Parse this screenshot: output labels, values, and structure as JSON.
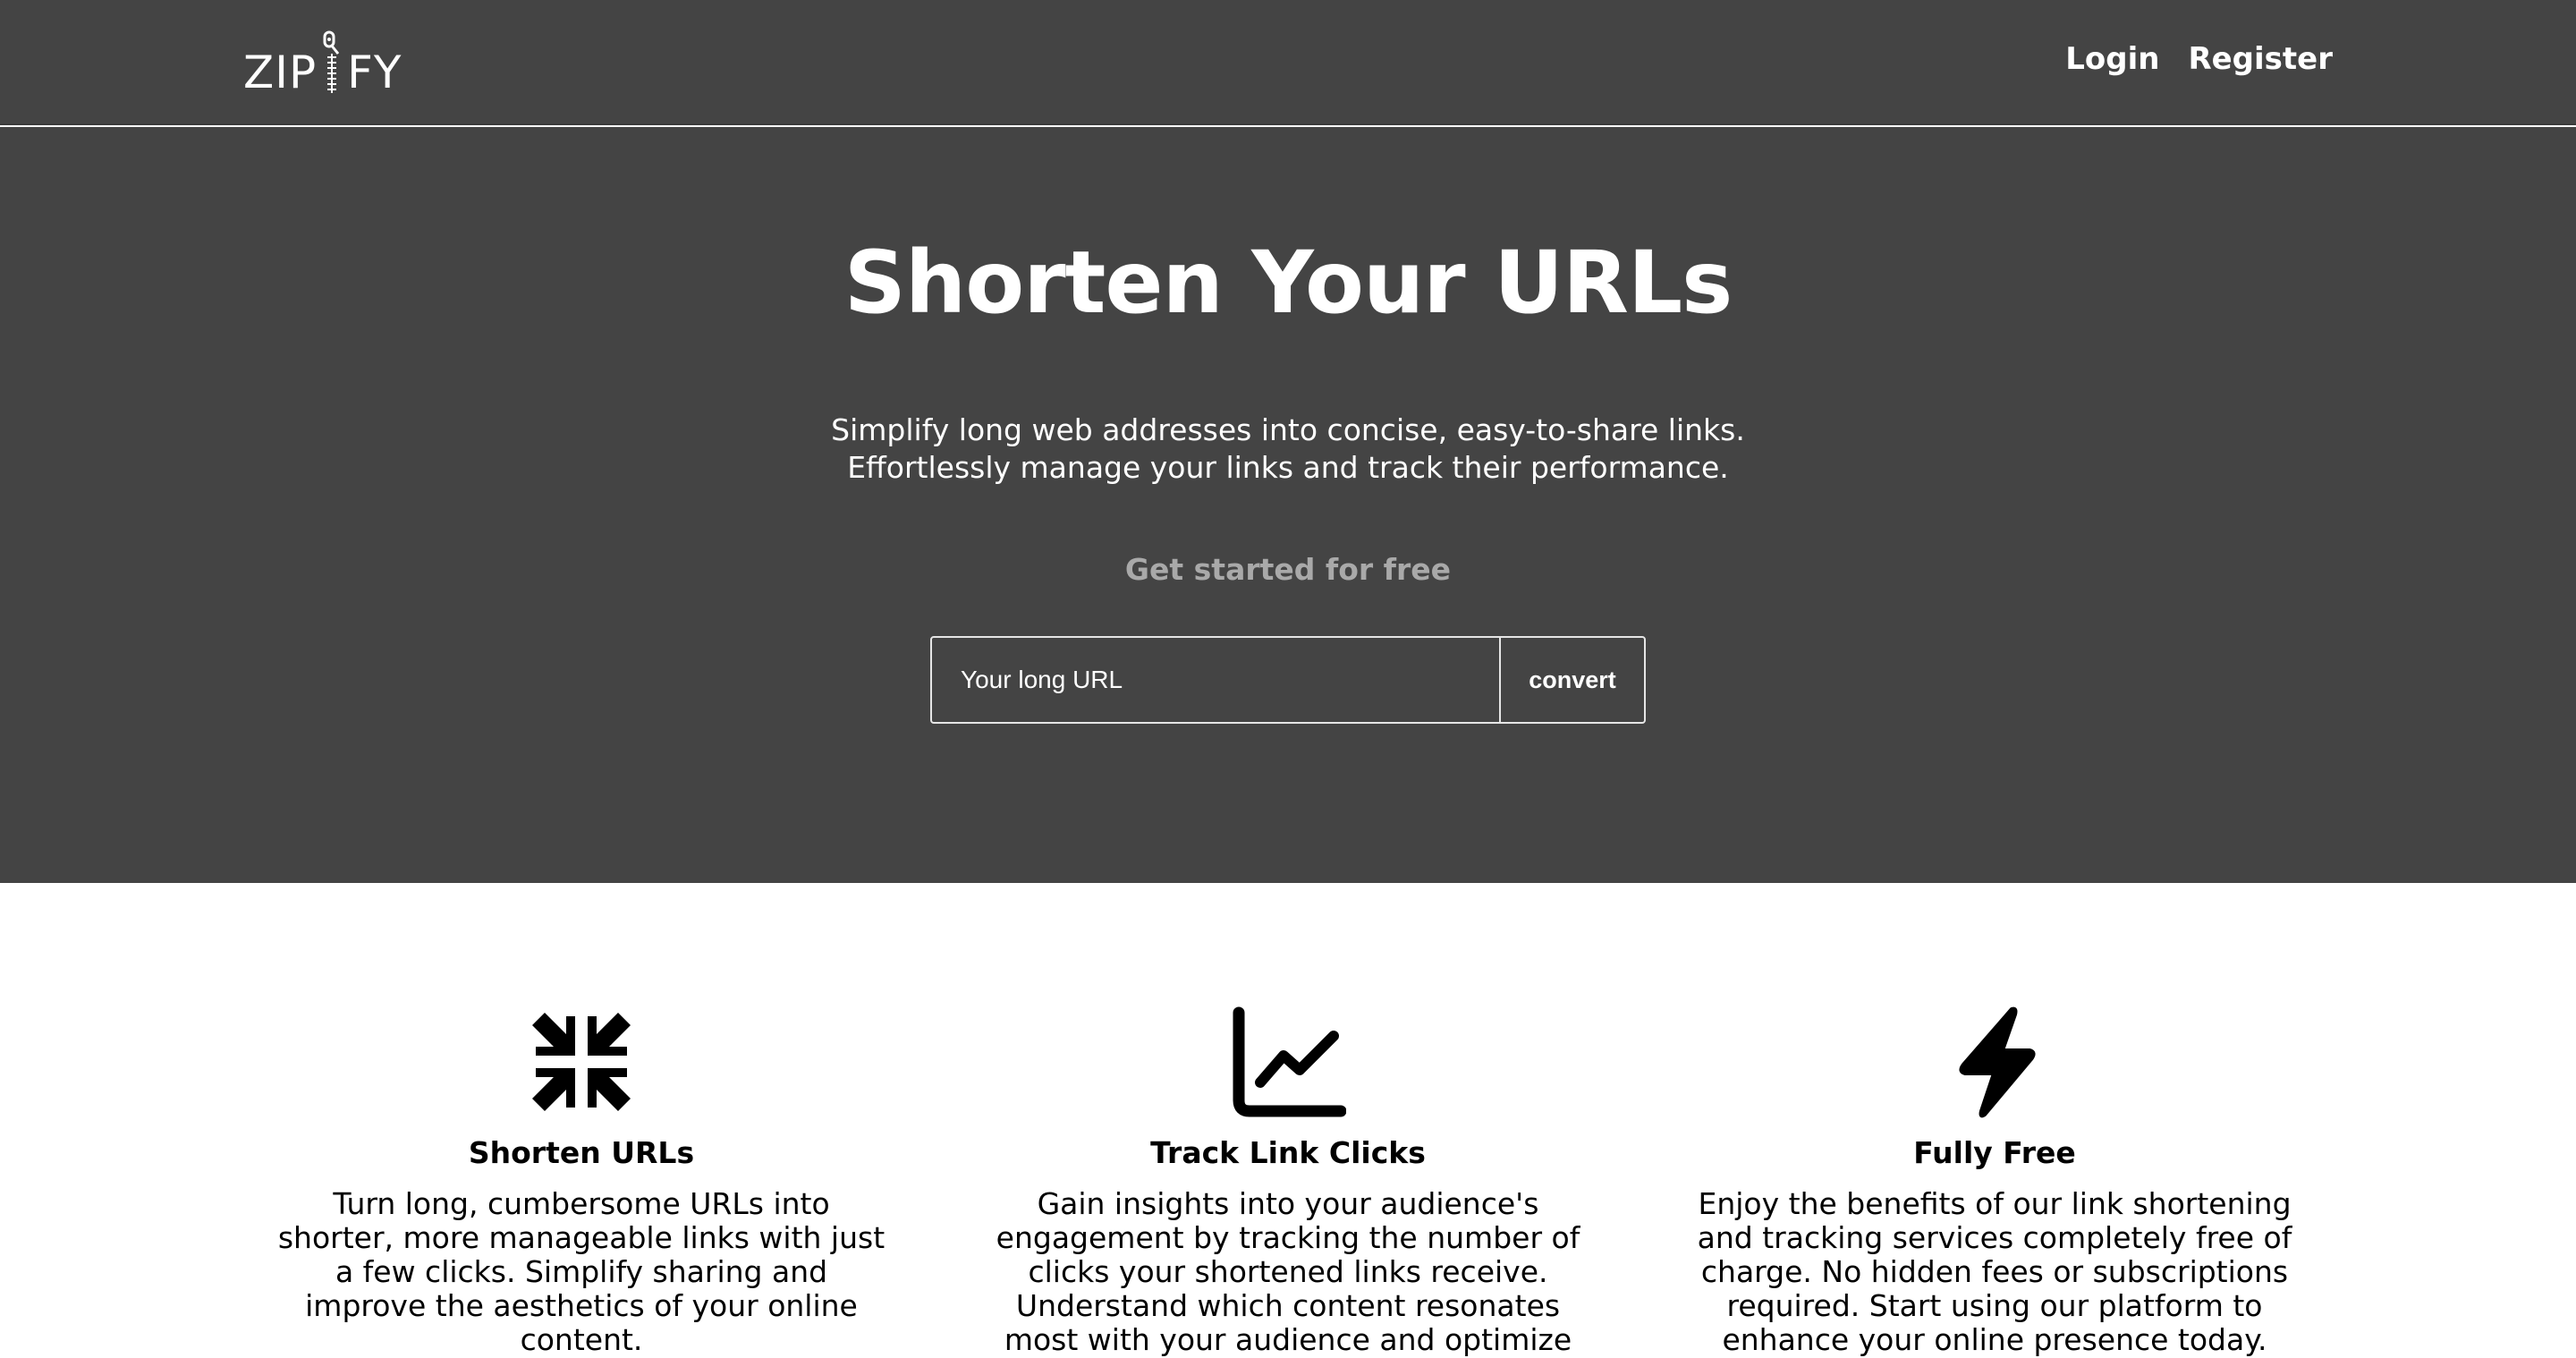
{
  "header": {
    "logo": {
      "left": "ZIP",
      "right": "FY"
    },
    "nav": {
      "login": "Login",
      "register": "Register"
    }
  },
  "hero": {
    "title": "Shorten Your URLs",
    "subtitle_line1": "Simplify long web addresses into concise, easy-to-share links.",
    "subtitle_line2": "Effortlessly manage your links and track their performance.",
    "cta": "Get started for free",
    "url_input": {
      "placeholder": "Your long URL",
      "value": ""
    },
    "convert_label": "convert"
  },
  "features": [
    {
      "icon": "compress-arrows-icon",
      "title": "Shorten URLs",
      "text": "Turn long, cumbersome URLs into shorter, more manageable links with just a few clicks. Simplify sharing and improve the aesthetics of your online content."
    },
    {
      "icon": "line-chart-icon",
      "title": "Track Link Clicks",
      "text": "Gain insights into your audience's engagement by tracking the number of clicks your shortened links receive. Understand which content resonates most with your audience and optimize your"
    },
    {
      "icon": "lightning-bolt-icon",
      "title": "Fully Free",
      "text": "Enjoy the benefits of our link shortening and tracking services completely free of charge. No hidden fees or subscriptions required. Start using our platform to enhance your online presence today."
    }
  ],
  "colors": {
    "hero_background": "#444444",
    "text_light": "#ffffff",
    "cta_gray": "#a9a9a9",
    "body_background": "#ffffff",
    "text_dark": "#000000"
  }
}
